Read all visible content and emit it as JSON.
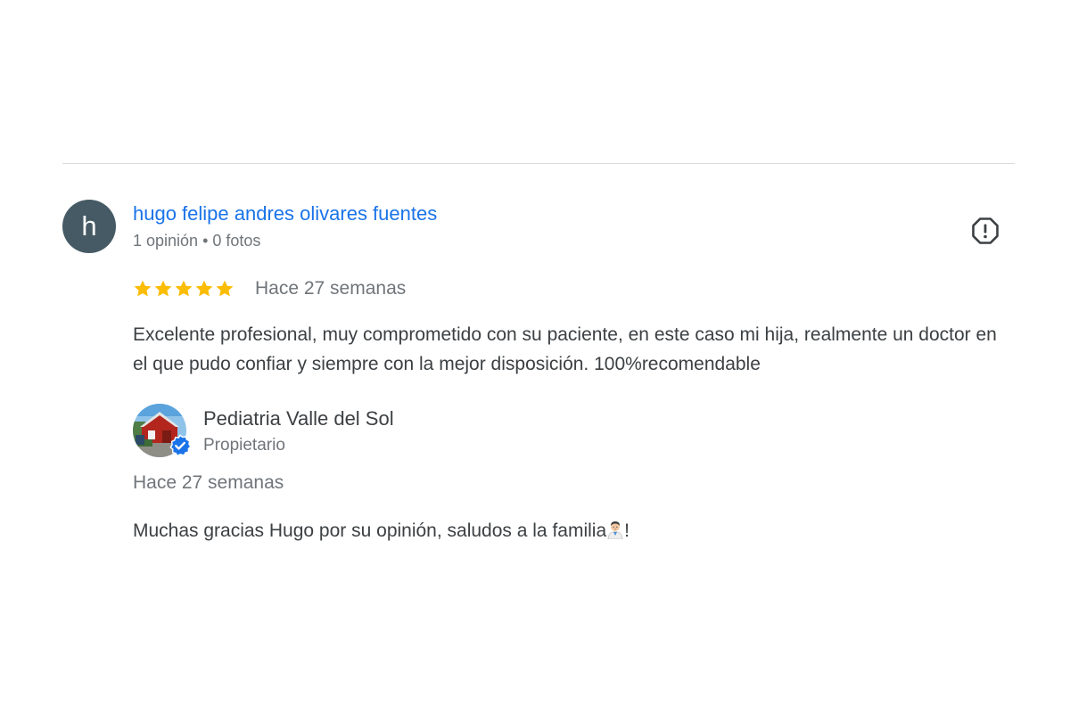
{
  "review": {
    "author_initial": "h",
    "author_name": "hugo felipe andres olivares fuentes",
    "author_meta": "1 opinión • 0 fotos",
    "rating": 5,
    "rating_max": 5,
    "date": "Hace 27 semanas",
    "text": "Excelente profesional, muy comprometido con su paciente, en este caso mi hija, realmente un doctor en el que pudo confiar y siempre con la mejor disposición. 100%recomendable",
    "icons": {
      "report": "report-flag-icon",
      "star": "star-icon"
    }
  },
  "owner_reply": {
    "name": "Pediatria Valle del Sol",
    "role": "Propietario",
    "date": "Hace 27 semanas",
    "text_before_emoji": "Muchas gracias Hugo por su opinión, saludos a la familia",
    "text_after_emoji": "!",
    "emoji": "health-worker-emoji",
    "verified_icon": "verified-badge-icon"
  },
  "colors": {
    "author_link": "#1a73e8",
    "star": "#fbbc04",
    "avatar_bg": "#455a64",
    "verified": "#1a73e8",
    "secondary_text": "#70757a",
    "primary_text": "#3c4043",
    "divider": "#dadce0"
  }
}
